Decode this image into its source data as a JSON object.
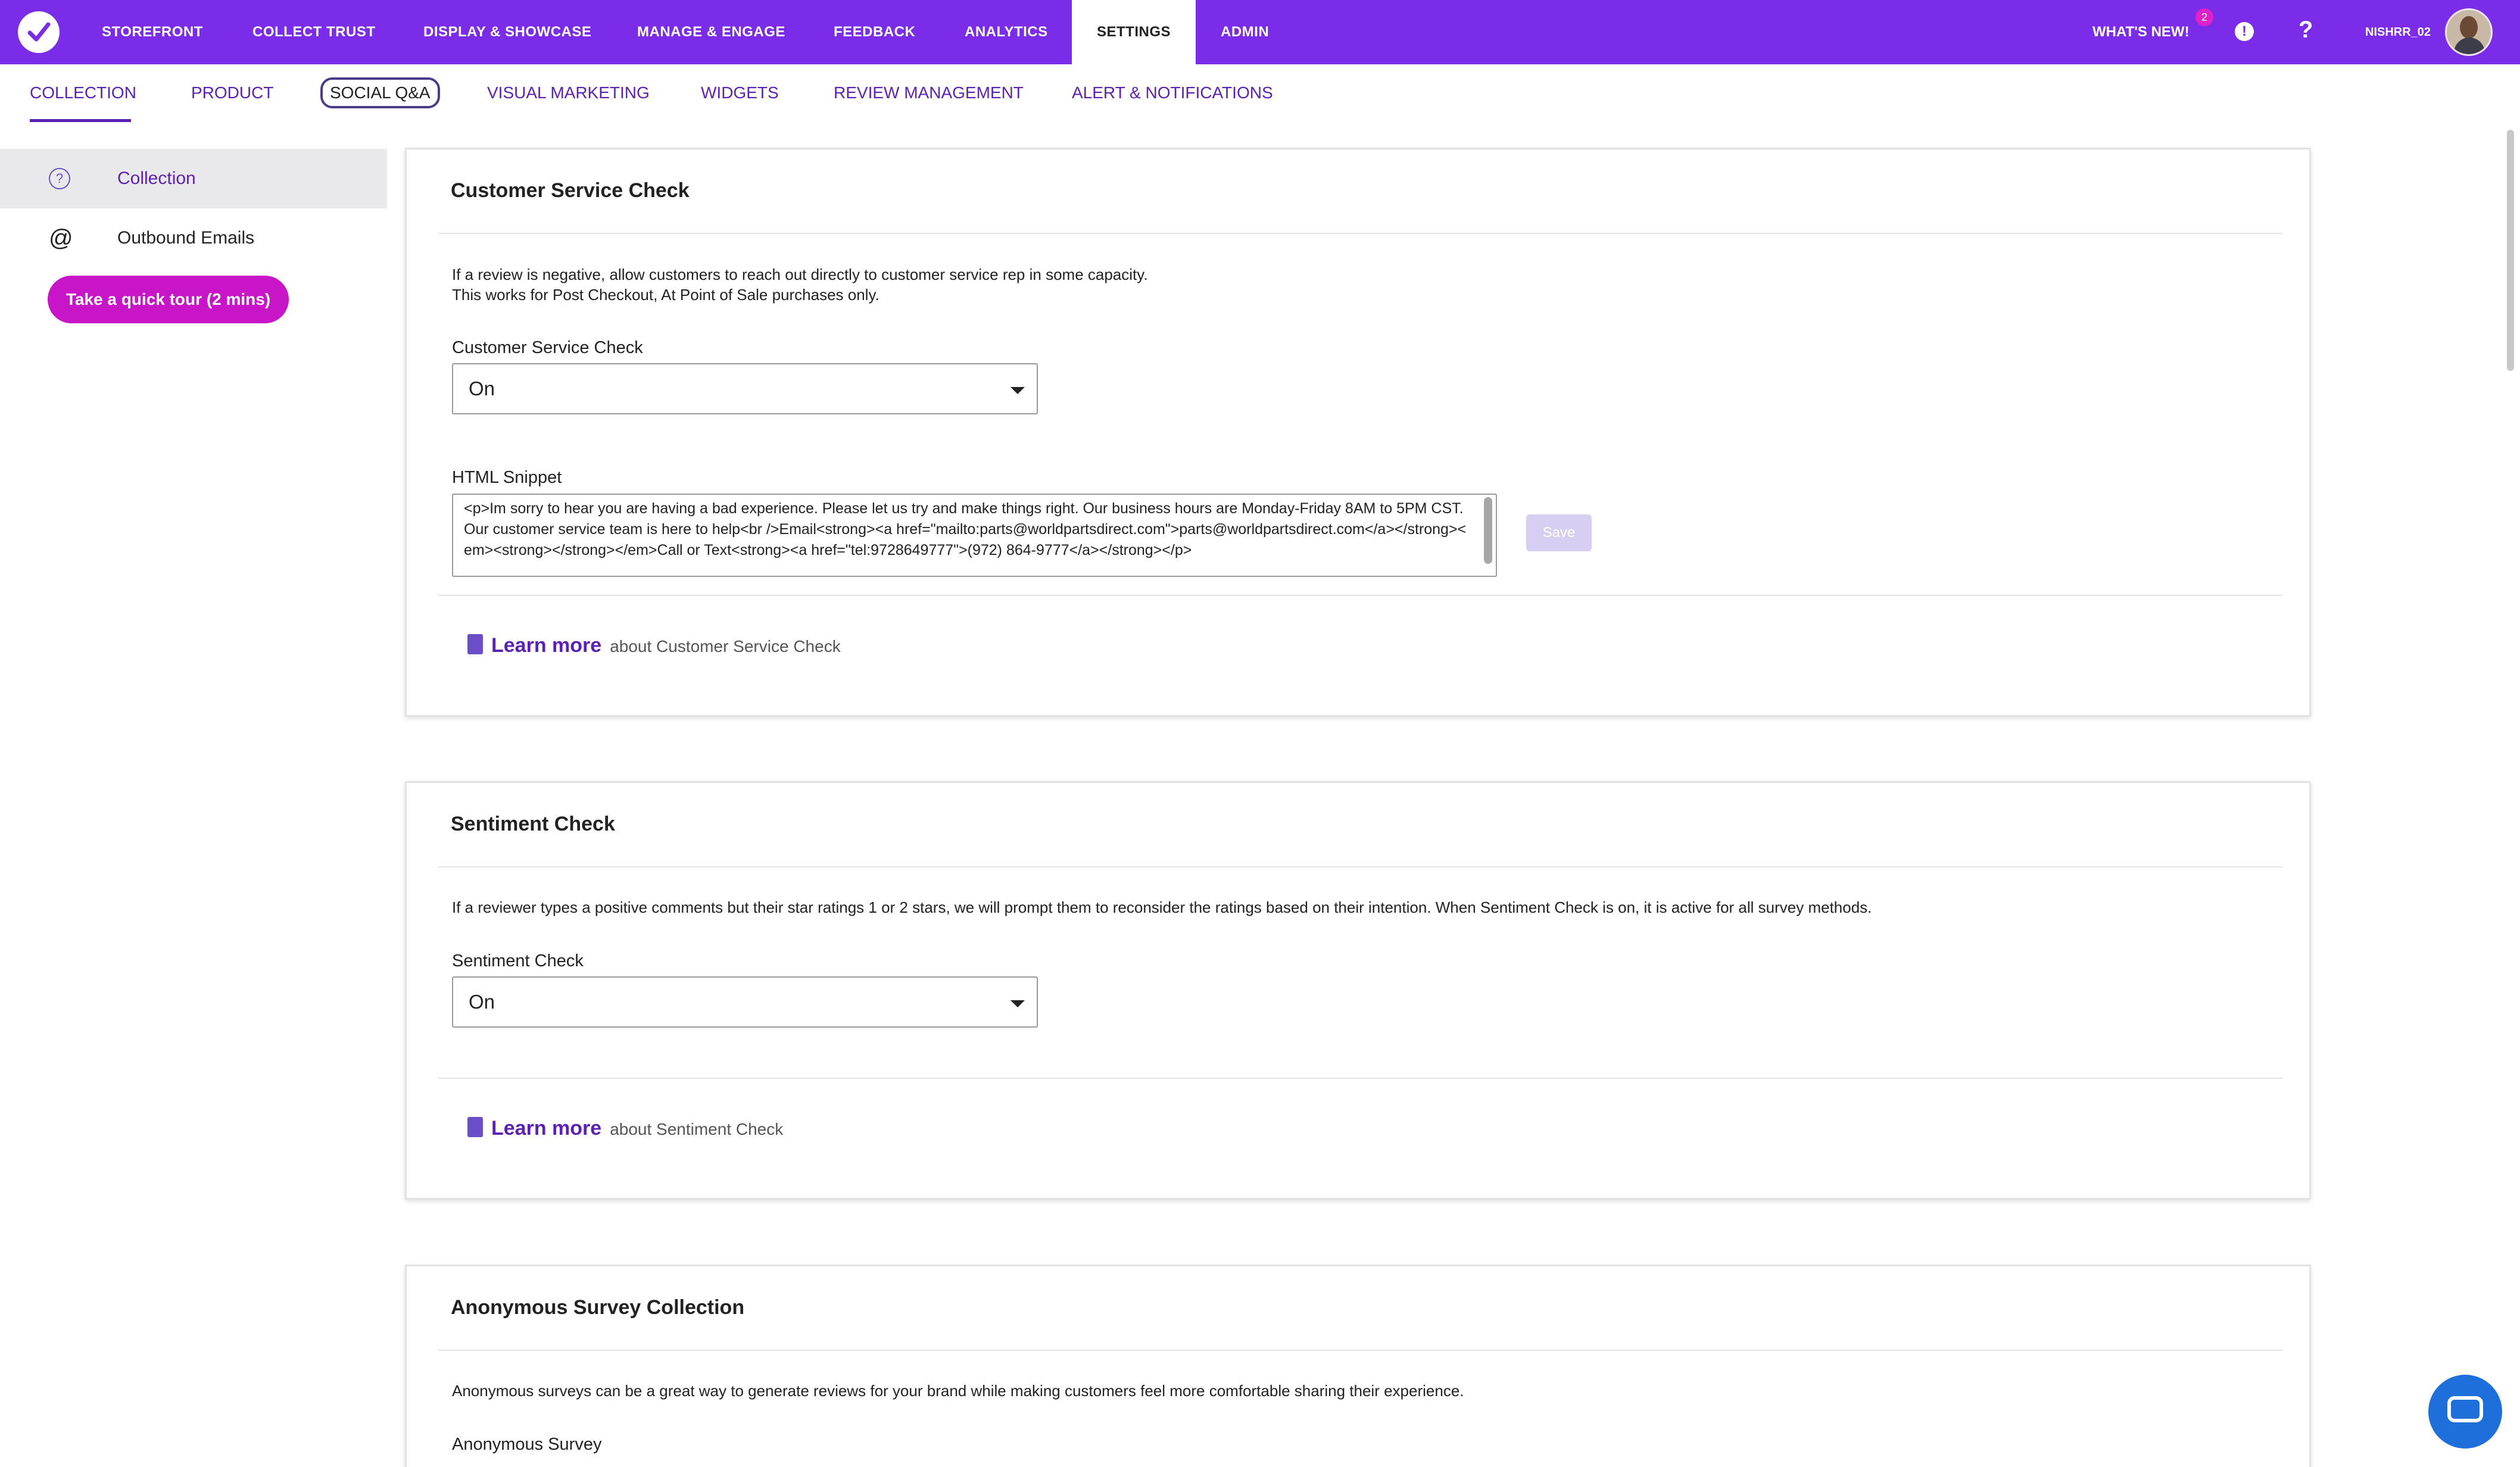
{
  "topnav": {
    "items": [
      "STOREFRONT",
      "COLLECT TRUST",
      "DISPLAY & SHOWCASE",
      "MANAGE & ENGAGE",
      "FEEDBACK",
      "ANALYTICS",
      "SETTINGS",
      "ADMIN"
    ],
    "active": "SETTINGS",
    "whats_new": "WHAT'S NEW!",
    "whats_new_badge": "2",
    "username": "NISHRR_02"
  },
  "subtabs": {
    "items": [
      "COLLECTION",
      "PRODUCT",
      "SOCIAL Q&A",
      "VISUAL MARKETING",
      "WIDGETS",
      "REVIEW MANAGEMENT",
      "ALERT & NOTIFICATIONS"
    ],
    "active": "COLLECTION"
  },
  "sidebar": {
    "items": [
      {
        "label": "Collection",
        "icon": "question-circle-icon"
      },
      {
        "label": "Outbound Emails",
        "icon": "at-icon"
      }
    ],
    "tour_button": "Take a quick tour (2 mins)"
  },
  "cards": {
    "customer_service": {
      "title": "Customer Service Check",
      "desc_line1": "If a review is negative, allow customers to reach out directly to customer service rep in some capacity.",
      "desc_line2": "This works for Post Checkout, At Point of Sale purchases only.",
      "field_label": "Customer Service Check",
      "field_value": "On",
      "snippet_label": "HTML Snippet",
      "snippet_value": "<p>Im sorry to hear you are having a bad experience. Please let us try and make things right. Our business hours are Monday-Friday 8AM to 5PM CST. Our customer service team is here to help<br />Email<strong><a href=\"mailto:parts@worldpartsdirect.com\">parts@worldpartsdirect.com</a></strong><em><strong></strong></em>Call or Text<strong><a href=\"tel:9728649777\">(972) 864-9777</a></strong></p>",
      "save_label": "Save",
      "learn_more": "Learn more",
      "learn_more_rest": "about Customer Service Check"
    },
    "sentiment": {
      "title": "Sentiment Check",
      "desc": "If a reviewer types a positive comments but their star ratings 1 or 2 stars, we will prompt them to reconsider the ratings based on their intention. When Sentiment Check is on, it is active for all survey methods.",
      "field_label": "Sentiment Check",
      "field_value": "On",
      "learn_more": "Learn more",
      "learn_more_rest": "about Sentiment Check"
    },
    "anonymous": {
      "title": "Anonymous Survey Collection",
      "desc": "Anonymous surveys can be a great way to generate reviews for your brand while making customers feel more comfortable sharing their experience.",
      "field_label": "Anonymous Survey"
    }
  },
  "colors": {
    "brand_purple": "#7b2ce8",
    "link_purple": "#5b21b6",
    "tour_magenta": "#c715c7",
    "chat_blue": "#1e6fd9"
  }
}
